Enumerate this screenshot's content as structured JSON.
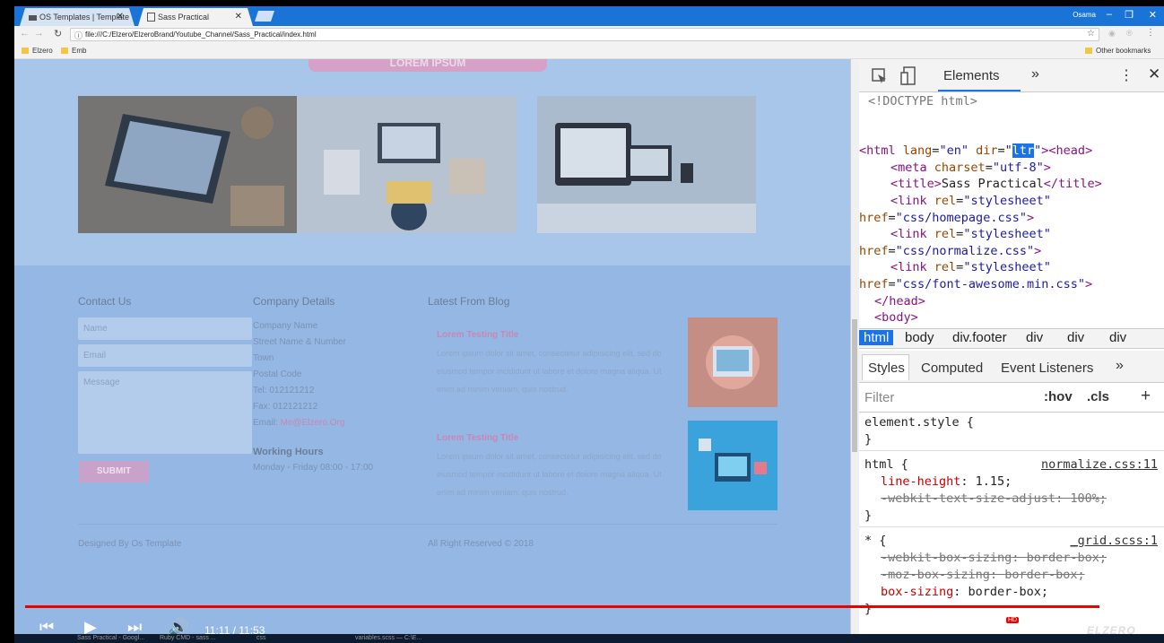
{
  "browser": {
    "tabs": [
      {
        "label": "OS Templates | Template"
      },
      {
        "label": "Sass Practical"
      }
    ],
    "user": "Osama",
    "window_buttons": {
      "minimize": "–",
      "maximize": "❐",
      "close": "✕"
    },
    "url": "file:///C:/Elzero/ElzeroBrand/Youtube_Channel/Sass_Practical/index.html",
    "bookmarks": [
      "Elzero",
      "Emb"
    ],
    "other_bookmarks": "Other bookmarks"
  },
  "page": {
    "hero_button": "LOREM IPSUM",
    "footer": {
      "contact_heading": "Contact Us",
      "name_placeholder": "Name",
      "email_placeholder": "Email",
      "message_placeholder": "Message",
      "submit_label": "SUBMIT",
      "company_heading": "Company Details",
      "company_lines": [
        "Company Name",
        "Street Name & Number",
        "Town",
        "Postal Code",
        "Tel: 012121212",
        "Fax: 012121212"
      ],
      "email_label": "Email: ",
      "email_value": "Me@Elzero.Org",
      "hours_heading": "Working Hours",
      "hours_value": "Monday - Friday 08:00 - 17:00",
      "blog_heading": "Latest From Blog",
      "posts": [
        {
          "title": "Lorem Testing Title",
          "text": "Lorem ipsum dolor sit amet, consectetur adipisicing elit, sed do eiusmod tempor incididunt ut labore et dolore magna aliqua. Ut enim ad minim veniam, quis nostrud."
        },
        {
          "title": "Lorem Testing Title",
          "text": "Lorem ipsum dolor sit amet, consectetur adipisicing elit, sed do eiusmod tempor incididunt ut labore et dolore magna aliqua. Ut enim ad minim veniam, quis nostrud."
        }
      ],
      "designed_by": "Designed By Os Template",
      "rights": "All Right Reserved © 2018"
    }
  },
  "devtools": {
    "elements_tab": "Elements",
    "more_tabs": "»",
    "doctype": "<!DOCTYPE html>",
    "breadcrumbs": [
      "html",
      "body",
      "div.footer",
      "div",
      "div",
      "div"
    ],
    "style_tabs": [
      "Styles",
      "Computed",
      "Event Listeners",
      "»"
    ],
    "filter_placeholder": "Filter",
    "hov": ":hov",
    "cls": ".cls",
    "add": "+",
    "rules": {
      "element_style": "element.style {",
      "html_selector": "html {",
      "html_source": "normalize.css:11",
      "line_height_prop": "line-height",
      "line_height_val": "1.15;",
      "webkit_text_prop": "-webkit-text-size-adjust",
      "webkit_text_val": "100%;",
      "star_selector": "* {",
      "star_source": "_grid.scss:1",
      "webkit_box_prop": "-webkit-box-sizing",
      "webkit_box_val": "border-box;",
      "moz_box_prop": "-moz-box-sizing",
      "moz_box_val": "border-box;",
      "box_prop": "box-sizing",
      "box_val": "border-box;",
      "close_brace": "}"
    }
  },
  "video": {
    "time": "11:11 / 11:53",
    "progress": 0.943,
    "hd_badge": "HD",
    "watermark": "ELZERO WEB"
  },
  "taskbar": {
    "items": [
      "Sass Practical - Googl...",
      "Ruby CMD - sass ...",
      "css",
      "variables.scss — C:\\E..."
    ]
  }
}
